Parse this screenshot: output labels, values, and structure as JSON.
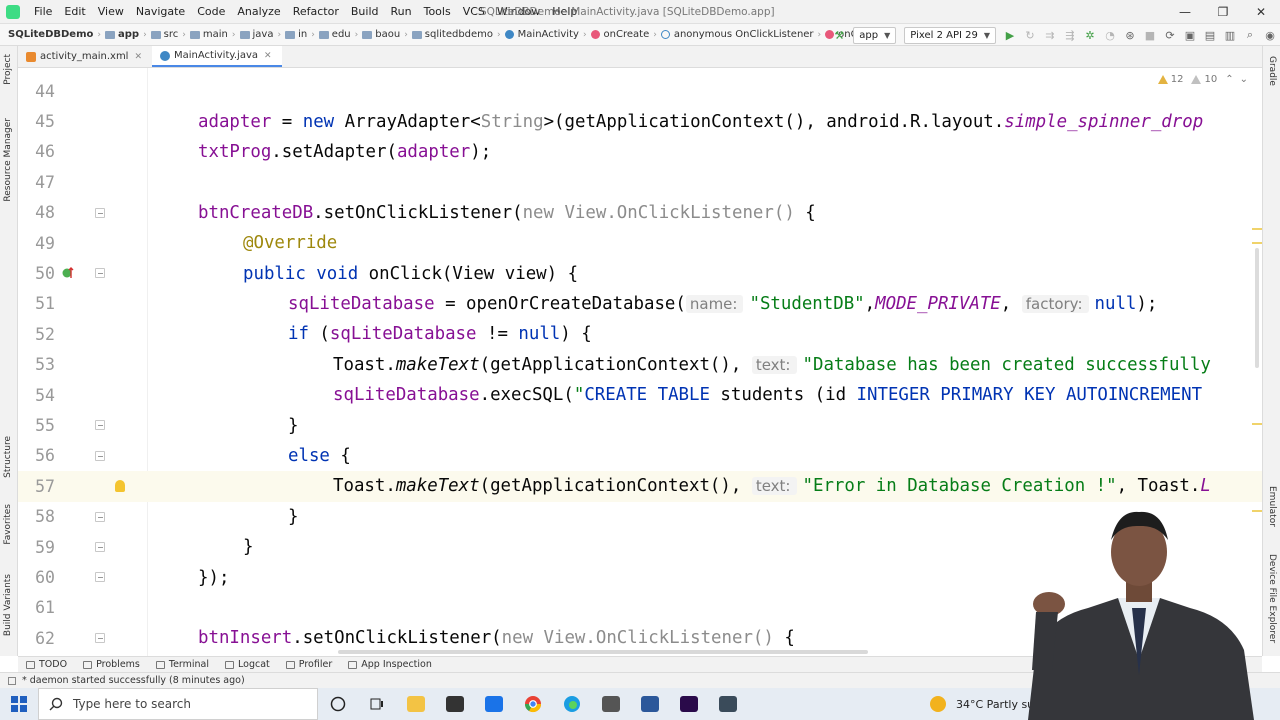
{
  "titlebar": {
    "menus": [
      "File",
      "Edit",
      "View",
      "Navigate",
      "Code",
      "Analyze",
      "Refactor",
      "Build",
      "Run",
      "Tools",
      "VCS",
      "Window",
      "Help"
    ],
    "window_title": "SQLiteDBDemo - MainActivity.java [SQLiteDBDemo.app]",
    "minimize": "—",
    "maximize": "❐",
    "close": "✕"
  },
  "navbar": {
    "crumbs": [
      "SQLiteDBDemo",
      "app",
      "src",
      "main",
      "java",
      "in",
      "edu",
      "baou",
      "sqlitedbdemo",
      "MainActivity",
      "onCreate",
      "anonymous OnClickListener",
      "onClick"
    ],
    "run_config": "app",
    "device": "Pixel 2 API 29"
  },
  "tabs": [
    {
      "label": "activity_main.xml"
    },
    {
      "label": "MainActivity.java"
    }
  ],
  "left_strip": [
    "Project",
    "Resource Manager",
    "Structure",
    "Favorites",
    "Build Variants"
  ],
  "right_strip": [
    "Gradle",
    "Emulator",
    "Device File Explorer"
  ],
  "inspection": {
    "warnings": "12",
    "weak_warnings": "10"
  },
  "code": {
    "line_numbers": [
      "44",
      "45",
      "46",
      "47",
      "48",
      "49",
      "50",
      "51",
      "52",
      "53",
      "54",
      "55",
      "56",
      "57",
      "58",
      "59",
      "60",
      "61",
      "62"
    ],
    "l45": {
      "a": "adapter",
      "b": " = ",
      "kw": "new",
      "c": " ArrayAdapter<",
      "type": "String",
      "d": ">(getApplicationContext(), android.R.layout.",
      "e": "simple_spinner_drop"
    },
    "l46": {
      "a": "txtProg",
      "b": ".setAdapter(",
      "c": "adapter",
      "d": ");"
    },
    "l48": {
      "a": "btnCreateDB",
      "b": ".setOnClickListener(",
      "c": "new View.OnClickListener()",
      "d": " {"
    },
    "l49": {
      "a": "@Override"
    },
    "l50": {
      "kw": "public void",
      "b": " onClick(View view) {"
    },
    "l51": {
      "a": "sqLiteDatabase",
      "b": " = openOrCreateDatabase(",
      "hint1": "name:",
      "s1": "\"StudentDB\"",
      "c": ",",
      "d": "MODE_PRIVATE",
      "e": ", ",
      "hint2": "factory:",
      "kw": "null",
      "f": ");"
    },
    "l52": {
      "kw": "if",
      "b": " (",
      "c": "sqLiteDatabase",
      "d": " != ",
      "kw2": "null",
      "e": ") {"
    },
    "l53": {
      "a": "Toast.",
      "b": "makeText",
      "c": "(getApplicationContext(), ",
      "hint": "text:",
      "s": "\"Database has been created successfully"
    },
    "l54": {
      "a": "sqLiteDatabase",
      "b": ".execSQL(",
      "s1": "\"",
      "k1": "CREATE TABLE",
      "s2": " students (id ",
      "k2": "INTEGER PRIMARY KEY AUTOINCREMENT"
    },
    "l55": {
      "a": "}"
    },
    "l56": {
      "kw": "else",
      "b": " {"
    },
    "l57": {
      "a": "Toast.",
      "b": "makeText",
      "c": "(getApplicationContext(), ",
      "hint": "text:",
      "s": "\"Error in Database Creation !\"",
      "d": ", Toast.",
      "e": "L"
    },
    "l58": {
      "a": "}"
    },
    "l59": {
      "a": "}"
    },
    "l60": {
      "a": "});"
    },
    "l62": {
      "a": "btnInsert",
      "b": ".setOnClickListener(",
      "c": "new View.OnClickListener()",
      "d": " {"
    }
  },
  "tool_windows": [
    "TODO",
    "Problems",
    "Terminal",
    "Logcat",
    "Profiler",
    "App Inspection"
  ],
  "status_text": "* daemon started successfully (8 minutes ago)",
  "taskbar": {
    "search_placeholder": "Type here to search",
    "weather": "34°C  Partly sunny"
  },
  "colors": {
    "keyword": "#0033b3",
    "string": "#067d17",
    "annotation": "#9e880d",
    "field": "#871094",
    "accent": "#4a88e6"
  }
}
